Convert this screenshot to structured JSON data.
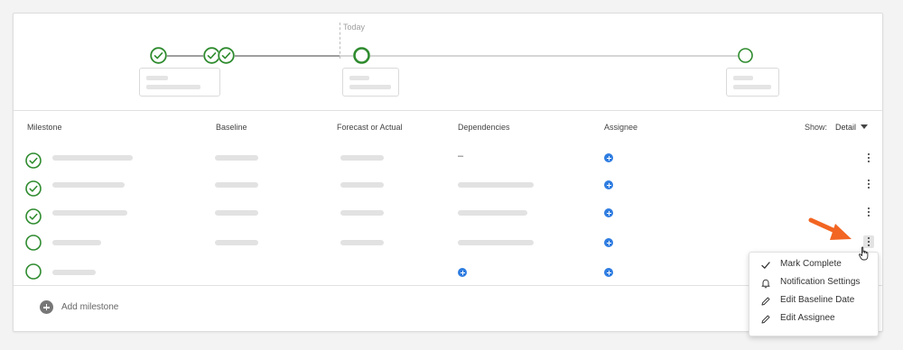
{
  "timeline": {
    "today_label": "Today"
  },
  "table": {
    "headers": {
      "milestone": "Milestone",
      "baseline": "Baseline",
      "forecast": "Forecast or Actual",
      "dependencies": "Dependencies",
      "assignee": "Assignee"
    },
    "show_label": "Show:",
    "show_value": "Detail",
    "rows": [
      {
        "status": "complete",
        "dependencies_text": "–",
        "assignee_icon": "add-assignee-icon"
      },
      {
        "status": "complete",
        "assignee_icon": "add-assignee-icon"
      },
      {
        "status": "complete",
        "assignee_icon": "add-assignee-icon"
      },
      {
        "status": "incomplete",
        "assignee_icon": "add-assignee-icon"
      },
      {
        "status": "incomplete",
        "dependencies_icon": "add-dependency-icon",
        "assignee_icon": "add-assignee-icon"
      }
    ]
  },
  "add_milestone": {
    "label": "Add milestone"
  },
  "menu": {
    "items": [
      {
        "label": "Mark Complete",
        "icon": "checkmark-icon"
      },
      {
        "label": "Notification Settings",
        "icon": "bell-icon"
      },
      {
        "label": "Edit Baseline Date",
        "icon": "pencil-icon"
      },
      {
        "label": "Edit Assignee",
        "icon": "pencil-icon"
      }
    ]
  },
  "colors": {
    "complete_green": "#2e8b2e",
    "action_blue": "#2f7de1",
    "annotation_arrow": "#f26522"
  }
}
